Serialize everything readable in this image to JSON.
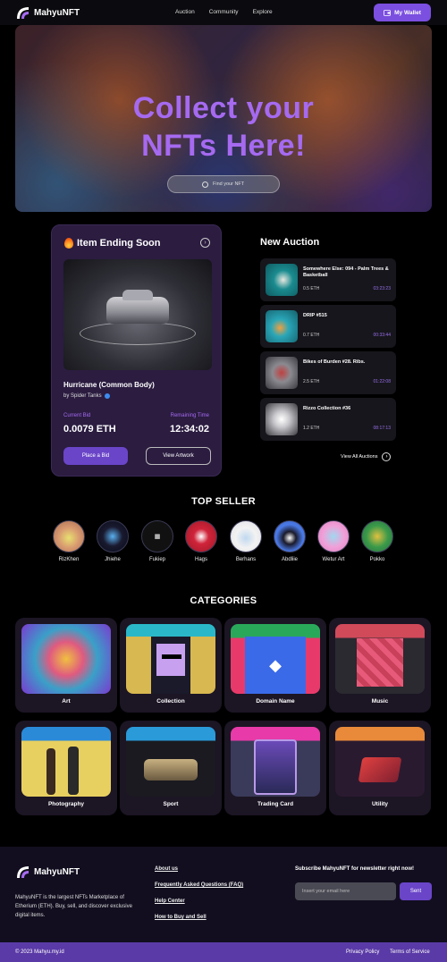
{
  "nav": {
    "brand": "MahyuNFT",
    "links": [
      "Auction",
      "Community",
      "Explore"
    ],
    "wallet_label": "My Wallet"
  },
  "hero": {
    "title_line1": "Collect your",
    "title_line2": "NFTs Here!",
    "search_placeholder": "Find your NFT"
  },
  "ending": {
    "heading": "Item Ending Soon",
    "item_name": "Hurricane (Common Body)",
    "creator": "by Spider Tanks",
    "bid_label": "Current Bid",
    "bid_value": "0.0079 ETH",
    "time_label": "Remaining Time",
    "time_value": "12:34:02",
    "bid_button": "Place a Bid",
    "view_button": "View Artwork"
  },
  "auction": {
    "heading": "New Auction",
    "items": [
      {
        "name": "Somewhere Else: 094 - Palm Trees & Basketball",
        "price": "0.5 ETH",
        "time": "03:23:23",
        "color": "#1a8b8f"
      },
      {
        "name": "DRIP #515",
        "price": "0.7 ETH",
        "time": "00:33:44",
        "color": "#2aa6b8"
      },
      {
        "name": "Bikes of Burden #28. Ribs.",
        "price": "2.5 ETH",
        "time": "01:22:08",
        "color": "#8a8a90"
      },
      {
        "name": "Rizzo Collection #36",
        "price": "1.2 ETH",
        "time": "08:17:13",
        "color": "#c8c8cc"
      }
    ],
    "view_all": "View All Auctions"
  },
  "sellers": {
    "heading": "TOP SELLER",
    "items": [
      {
        "name": "RizKhen",
        "color": "#d89a70"
      },
      {
        "name": "Jhiehe",
        "color": "#1a1a30"
      },
      {
        "name": "Fukiep",
        "color": "#111111"
      },
      {
        "name": "Hags",
        "color": "#d0243a"
      },
      {
        "name": "Berhans",
        "color": "#f2f2f2"
      },
      {
        "name": "Abdliie",
        "color": "#4a7ae8"
      },
      {
        "name": "Wetur Art",
        "color": "#f0a0d8"
      },
      {
        "name": "Pokko",
        "color": "#3a9a4a"
      }
    ]
  },
  "categories": {
    "heading": "CATEGORIES",
    "items": [
      {
        "label": "Art",
        "color": "#7a3ad0"
      },
      {
        "label": "Collection",
        "color": "#2ab8c8"
      },
      {
        "label": "Domain Name",
        "color": "#2aa85a"
      },
      {
        "label": "Music",
        "color": "#d04a5a"
      },
      {
        "label": "Photography",
        "color": "#2a8ad8"
      },
      {
        "label": "Sport",
        "color": "#2a9ad8"
      },
      {
        "label": "Trading Card",
        "color": "#e83aa8"
      },
      {
        "label": "Utility",
        "color": "#e88a3a"
      }
    ]
  },
  "footer": {
    "brand": "MahyuNFT",
    "description": "MahyuNFT is the largest NFTs Marketplace of Etherium (ETH). Buy, sell, and discover exclusive digital items.",
    "links": [
      "About us",
      "Frequently Asked Questions (FAQ)",
      "Help Center",
      "How to Buy and Sell"
    ],
    "subscribe_heading": "Subscribe MahyuNFT  for newsletter right now!",
    "email_placeholder": "Insert your email here",
    "send_label": "Sent",
    "copyright": "© 2023 Mahyu.my.id",
    "privacy": "Privacy Policy",
    "terms": "Terms of Service"
  }
}
